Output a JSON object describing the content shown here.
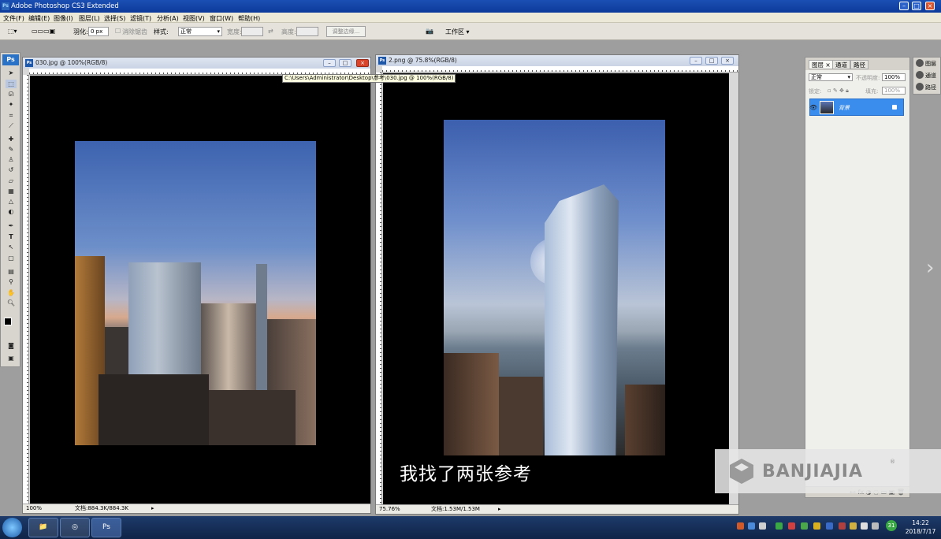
{
  "app": {
    "title": "Adobe Photoshop CS3 Extended"
  },
  "menu": [
    "文件(F)",
    "编辑(E)",
    "图像(I)",
    "图层(L)",
    "选择(S)",
    "滤镜(T)",
    "分析(A)",
    "视图(V)",
    "窗口(W)",
    "帮助(H)"
  ],
  "options": {
    "feather_label": "羽化:",
    "feather_value": "0 px",
    "antialias_label": "消除锯齿",
    "style_label": "样式:",
    "style_value": "正常",
    "width_label": "宽度:",
    "height_label": "高度:",
    "refine_edge": "调整边缘...",
    "workspace": "工作区 ▾"
  },
  "tools": {
    "logo": "Ps"
  },
  "doc1": {
    "title": "030.jpg @ 100%(RGB/8)",
    "zoom": "100%",
    "docsize": "文档:884.3K/884.3K"
  },
  "doc2": {
    "title": "2.png @ 75.8%(RGB/8)",
    "zoom": "75.76%",
    "docsize": "文档:1.53M/1.53M"
  },
  "tooltip": "C:\\Users\\Administrator\\Desktop\\参考\\030.jpg @ 100%(RGB/8)",
  "layers_panel": {
    "tabs": [
      "图层 ×",
      "通道",
      "路径"
    ],
    "blend_mode": "正常",
    "opacity_label": "不透明度:",
    "opacity_value": "100%",
    "lock_label": "锁定:",
    "fill_label": "填充:",
    "fill_value": "100%",
    "layer_name": "背景"
  },
  "dock": [
    "图层",
    "通道",
    "路径"
  ],
  "subtitle": "我找了两张参考",
  "watermark": {
    "text": "BANJIAJIA",
    "mark": "®"
  },
  "taskbar": {
    "time": "14:22",
    "date": "2018/7/17",
    "ps_button": "Ps",
    "tray_badge": "31"
  },
  "colors": {
    "titlebar": "#0c3a9a",
    "selected_layer": "#3b8ded",
    "canvas": "#000000"
  }
}
